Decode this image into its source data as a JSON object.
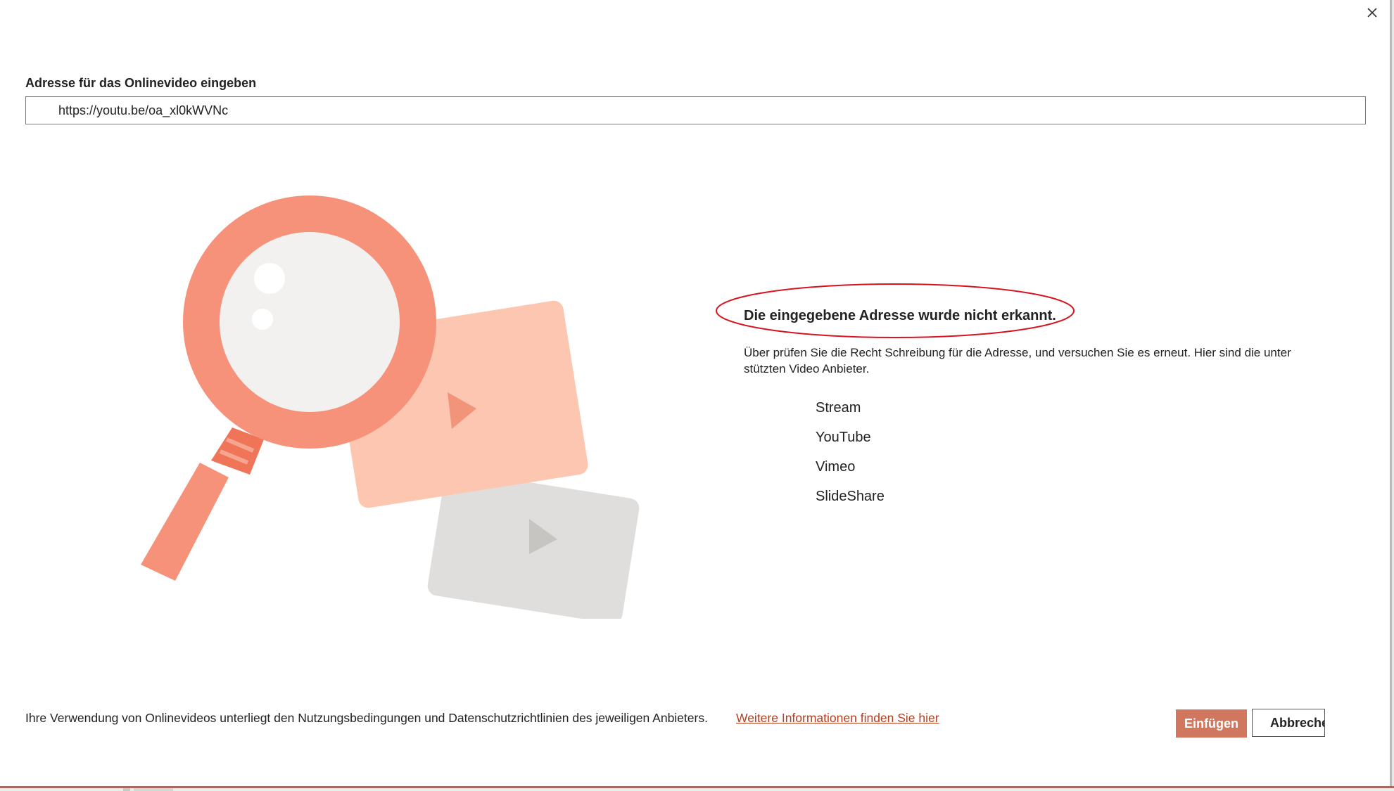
{
  "dialog": {
    "url_label": "Adresse für das Onlinevideo eingeben",
    "url_value": "https://youtu.be/oa_xl0kWVNc"
  },
  "error": {
    "title": "Die eingegebene Adresse wurde nicht erkannt.",
    "description": "Über prüfen Sie die Recht Schreibung für die Adresse, und versuchen Sie es erneut. Hier sind die unter stützten Video Anbieter.",
    "highlight_color": "#d8131f"
  },
  "providers": [
    "Stream",
    "YouTube",
    "Vimeo",
    "SlideShare"
  ],
  "footer": {
    "notice": "Ihre Verwendung von Onlinevideos unterliegt den Nutzungsbedingungen und Datenschutzrichtlinien des jeweiligen Anbieters.",
    "link": "Weitere Informationen finden Sie hier"
  },
  "buttons": {
    "insert": "Einfügen",
    "cancel": "Abbrechen"
  },
  "colors": {
    "accent": "#d1775f",
    "magnifier": "#f6927a",
    "link": "#b53f1f"
  },
  "icons": {
    "close": "close-icon",
    "illustration": "magnifier-video-illustration"
  }
}
